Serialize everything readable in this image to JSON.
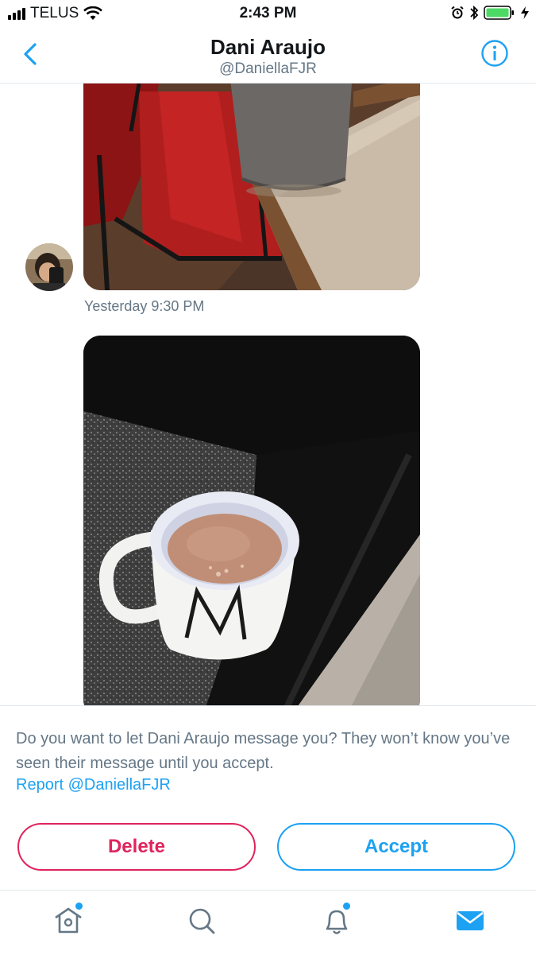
{
  "status_bar": {
    "carrier": "TELUS",
    "time": "2:43 PM",
    "icons": [
      "signal-icon",
      "wifi-icon",
      "alarm-icon",
      "bluetooth-icon",
      "battery-icon",
      "charging-icon"
    ]
  },
  "header": {
    "title": "Dani Araujo",
    "handle": "@DaniellaFJR",
    "back_icon": "chevron-left-icon",
    "info_icon": "info-icon"
  },
  "conversation": {
    "messages": [
      {
        "type": "image",
        "description_icon": "photo-icon"
      },
      {
        "type": "image",
        "description_icon": "photo-icon"
      }
    ],
    "timestamp": "Yesterday 9:30 PM"
  },
  "request": {
    "text": "Do you want to let Dani Araujo message you? They won’t know you’ve seen their message until you accept.",
    "report_link": "Report @DaniellaFJR",
    "delete_label": "Delete",
    "accept_label": "Accept"
  },
  "tabbar": {
    "items": [
      "home-icon",
      "search-icon",
      "notifications-icon",
      "messages-icon"
    ]
  },
  "colors": {
    "accent": "#1da1f2",
    "danger": "#e0245e",
    "secondary_text": "#657786",
    "divider": "#e1e8ed"
  }
}
